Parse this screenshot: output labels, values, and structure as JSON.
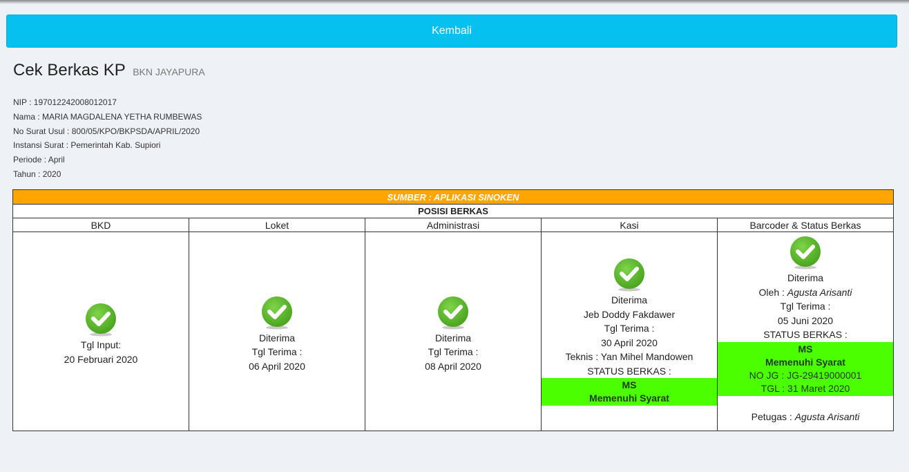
{
  "back_button": {
    "label": "Kembali"
  },
  "header": {
    "title": "Cek Berkas KP",
    "subtitle": "BKN JAYAPURA"
  },
  "info": {
    "nip": "NIP : 197012242008012017",
    "nama": "Nama : MARIA MAGDALENA YETHA RUMBEWAS",
    "no_surat": "No Surat Usul : 800/05/KPO/BKPSDA/APRIL/2020",
    "instansi": "Instansi Surat : Pemerintah Kab. Supiori",
    "periode": "Periode : April",
    "tahun": "Tahun : 2020"
  },
  "table": {
    "sumber": "SUMBER : APLIKASI SINOKEN",
    "posisi": "POSISI BERKAS",
    "columns": [
      "BKD",
      "Loket",
      "Administrasi",
      "Kasi",
      "Barcoder & Status Berkas"
    ],
    "bkd": {
      "label": "Tgl Input:",
      "date": "20 Februari 2020"
    },
    "loket": {
      "status": "Diterima",
      "label": "Tgl Terima :",
      "date": "06 April 2020"
    },
    "administrasi": {
      "status": "Diterima",
      "label": "Tgl Terima :",
      "date": "08 April 2020"
    },
    "kasi": {
      "status": "Diterima",
      "name": "Jeb Doddy Fakdawer",
      "label": "Tgl Terima :",
      "date": "30 April 2020",
      "teknis": "Teknis : Yan Mihel Mandowen",
      "status_label": "STATUS BERKAS :",
      "code": "MS",
      "desc": "Memenuhi Syarat"
    },
    "barcoder": {
      "status": "Diterima",
      "oleh_label": "Oleh :",
      "oleh_name": "Agusta Arisanti",
      "label": "Tgl Terima :",
      "date": "05 Juni 2020",
      "status_label": "STATUS BERKAS :",
      "code": "MS",
      "desc": "Memenuhi Syarat",
      "no_jg": "NO JG : JG-29419000001",
      "tgl": "TGL : 31 Maret 2020",
      "petugas_label": "Petugas :",
      "petugas_name": "Agusta Arisanti"
    }
  },
  "colors": {
    "accent": "#06c1ef",
    "orange": "#ffa500",
    "status_green": "#4cff00",
    "check_green": "#5cb82d"
  },
  "icons": {
    "check": "check-circle-icon"
  }
}
